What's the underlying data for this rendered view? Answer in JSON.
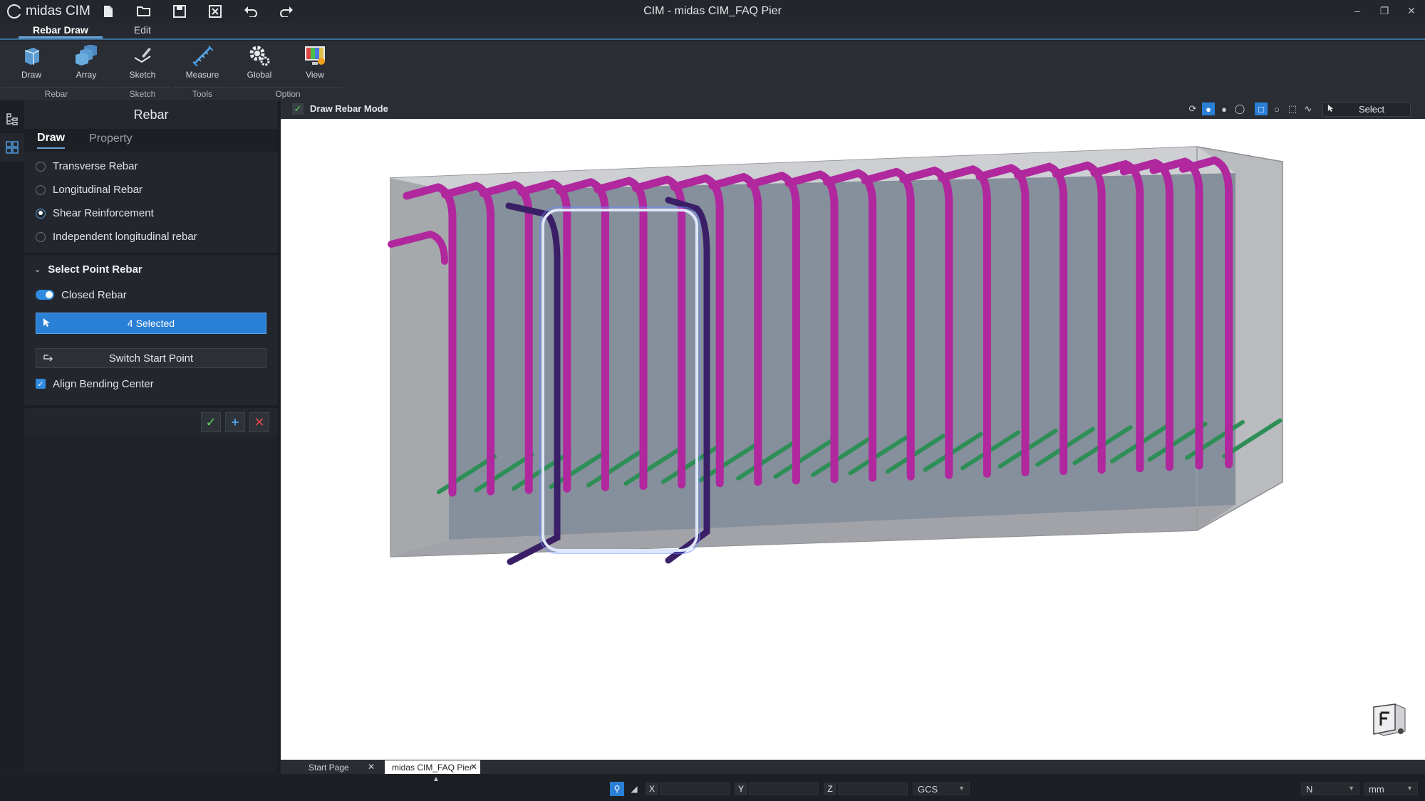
{
  "app": {
    "logo_text": "midas CIM",
    "window_title": "CIM - midas CIM_FAQ Pier"
  },
  "ribbon": {
    "tabs": [
      "Rebar Draw",
      "Edit"
    ],
    "tools": [
      {
        "label": "Draw",
        "icon": "draw-icon"
      },
      {
        "label": "Array",
        "icon": "array-icon"
      },
      {
        "label": "Sketch",
        "icon": "sketch-icon"
      },
      {
        "label": "Measure",
        "icon": "measure-icon"
      },
      {
        "label": "Global",
        "icon": "gear-icon"
      },
      {
        "label": "View",
        "icon": "view-icon"
      }
    ],
    "groups": [
      "Rebar",
      "Sketch",
      "Tools",
      "Option"
    ]
  },
  "panel": {
    "title": "Rebar",
    "tabs": [
      "Draw",
      "Property"
    ],
    "rebar_types": [
      {
        "label": "Transverse Rebar",
        "selected": false
      },
      {
        "label": "Longitudinal Rebar",
        "selected": false
      },
      {
        "label": "Shear Reinforcement",
        "selected": true
      },
      {
        "label": "Independent longitudinal rebar",
        "selected": false
      }
    ],
    "select_point": {
      "heading": "Select Point Rebar",
      "closed_rebar_label": "Closed Rebar",
      "closed_rebar_on": true,
      "selected_label": "4 Selected",
      "switch_label": "Switch Start Point",
      "align_label": "Align Bending Center",
      "align_checked": true
    }
  },
  "viewbar": {
    "mode_label": "Draw Rebar Mode",
    "select_label": "Select"
  },
  "doc_tabs": [
    "Start Page",
    "midas CIM_FAQ Pier"
  ],
  "status": {
    "x_label": "X",
    "y_label": "Y",
    "z_label": "Z",
    "coord_system": "GCS",
    "force_unit": "N",
    "length_unit": "mm"
  },
  "colors": {
    "accent": "#2a7fd6",
    "rebar_magenta": "#b0279e",
    "rebar_selected": "#3a1f66",
    "rebar_green": "#2d8f56"
  }
}
